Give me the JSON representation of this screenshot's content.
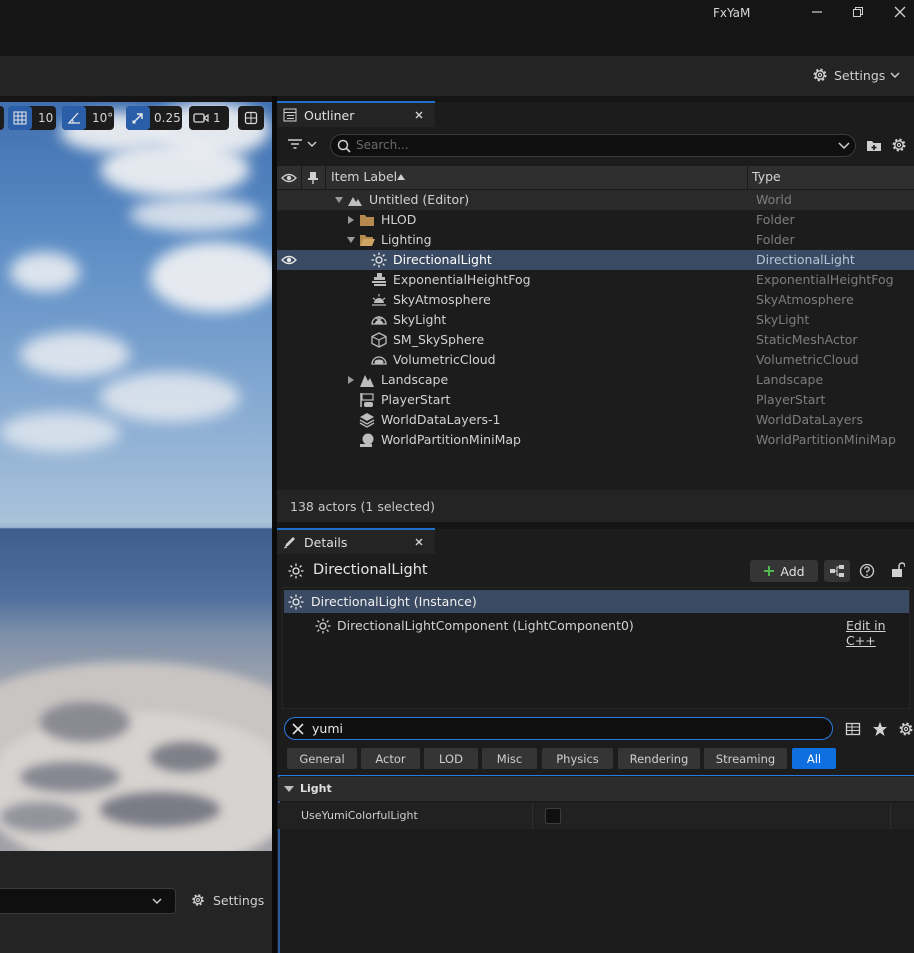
{
  "window": {
    "title": "FxYaM"
  },
  "toolbar": {
    "settings_label": "Settings"
  },
  "viewport": {
    "grid_snap": "10",
    "rotation_snap": "10°",
    "scale_snap": "0.25",
    "camera_speed": "1",
    "settings_label": "Settings"
  },
  "outliner": {
    "tab_label": "Outliner",
    "search_placeholder": "Search...",
    "col_item_label": "Item Label",
    "col_type": "Type",
    "rows": [
      {
        "label": "Untitled (Editor)",
        "type": "World"
      },
      {
        "label": "HLOD",
        "type": "Folder"
      },
      {
        "label": "Lighting",
        "type": "Folder"
      },
      {
        "label": "DirectionalLight",
        "type": "DirectionalLight"
      },
      {
        "label": "ExponentialHeightFog",
        "type": "ExponentialHeightFog"
      },
      {
        "label": "SkyAtmosphere",
        "type": "SkyAtmosphere"
      },
      {
        "label": "SkyLight",
        "type": "SkyLight"
      },
      {
        "label": "SM_SkySphere",
        "type": "StaticMeshActor"
      },
      {
        "label": "VolumetricCloud",
        "type": "VolumetricCloud"
      },
      {
        "label": "Landscape",
        "type": "Landscape"
      },
      {
        "label": "PlayerStart",
        "type": "PlayerStart"
      },
      {
        "label": "WorldDataLayers-1",
        "type": "WorldDataLayers"
      },
      {
        "label": "WorldPartitionMiniMap",
        "type": "WorldPartitionMiniMap"
      }
    ],
    "status": "138 actors (1 selected)"
  },
  "details": {
    "tab_label": "Details",
    "actor_name": "DirectionalLight",
    "add_label": "Add",
    "instance_label": "DirectionalLight (Instance)",
    "component_label": "DirectionalLightComponent (LightComponent0)",
    "edit_cpp": "Edit in C++",
    "search_value": "yumi",
    "filters": [
      "General",
      "Actor",
      "LOD",
      "Misc",
      "Physics",
      "Rendering",
      "Streaming",
      "All"
    ],
    "active_filter": "All",
    "category": "Light",
    "property_name": "UseYumiColorfulLight",
    "property_value": false
  },
  "colors": {
    "accent": "#1e6fcc",
    "selected_row": "#3a4a62",
    "panel": "#1c1c1c"
  }
}
